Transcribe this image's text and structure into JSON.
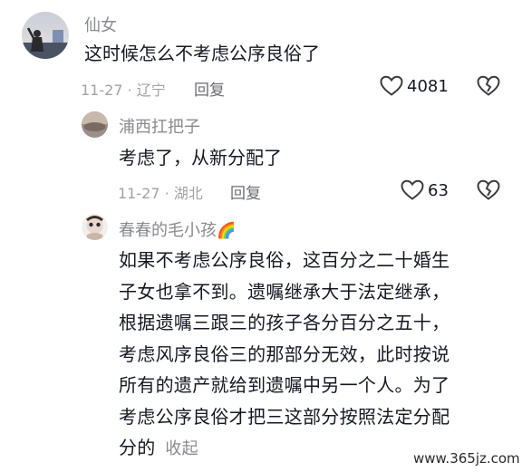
{
  "comments": [
    {
      "username": "仙女",
      "text": "这时候怎么不考虑公序良俗了",
      "date_location": "11-27 · 辽宁",
      "reply_label": "回复",
      "like_count": "4081"
    },
    {
      "username": "浦西扛把子",
      "text": "考虑了，从新分配了",
      "date_location": "11-27 · 湖北",
      "reply_label": "回复",
      "like_count": "63"
    },
    {
      "username": "春春的毛小孩",
      "username_emoji": "🌈",
      "lines": [
        "如果不考虑公序良俗，这百分之二十婚生",
        "子女也拿不到。遗嘱继承大于法定继承，",
        "根据遗嘱三跟三的孩子各分百分之五十，",
        "考虑风序良俗三的那部分无效，此时按说",
        "所有的遗产就给到遗嘱中另一个人。为了",
        "考虑公序良俗才把三这部分按照法定分配",
        "分的"
      ],
      "collapse_label": "收起"
    }
  ],
  "watermark": "www.365jz.com",
  "icons": {
    "like": "heart-outline-icon",
    "dislike": "broken-heart-icon"
  }
}
